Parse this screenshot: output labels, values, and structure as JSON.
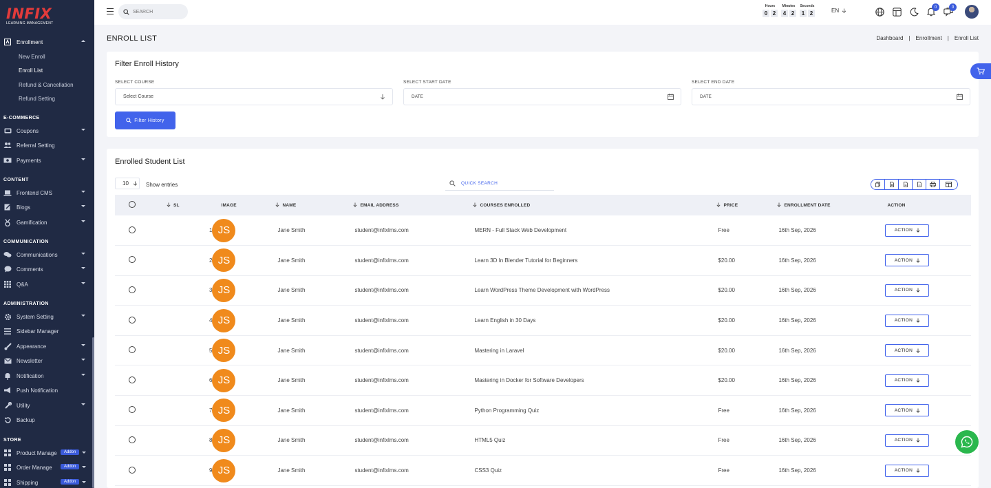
{
  "brand": {
    "logo_text": "INFIX",
    "logo_sub": "LEARNING MANAGEMENT"
  },
  "sidebar": {
    "enrollment": {
      "label": "Enrollment",
      "icon": "enrollment-icon",
      "sub": [
        "New Enroll",
        "Enroll List",
        "Refund & Cancellation",
        "Refund Setting"
      ],
      "active_sub": "Enroll List"
    },
    "sections": {
      "ecommerce": "E-COMMERCE",
      "content": "CONTENT",
      "communication": "COMMUNICATION",
      "administration": "ADMINISTRATION",
      "store": "STORE"
    },
    "ecommerce_items": [
      "Coupons",
      "Referral Setting",
      "Payments"
    ],
    "content_items": [
      "Frontend CMS",
      "Blogs",
      "Gamification"
    ],
    "communication_items": [
      "Communications",
      "Comments",
      "Q&A"
    ],
    "administration_items": [
      "System Setting",
      "Sidebar Manager",
      "Appearance",
      "Newsletter",
      "Notification",
      "Push Notification",
      "Utility",
      "Backup"
    ],
    "store_items": [
      "Product Manage",
      "Order Manage",
      "Shipping"
    ],
    "addon_label": "Addon"
  },
  "topbar": {
    "search_placeholder": "SEARCH",
    "timer": {
      "hours_label": "Hours",
      "minutes_label": "Minutes",
      "seconds_label": "Seconds",
      "hours": [
        "0",
        "2"
      ],
      "minutes": [
        "4",
        "2"
      ],
      "seconds": [
        "1",
        "2"
      ]
    },
    "language": "EN",
    "notification_count": "0",
    "message_count": "0"
  },
  "page": {
    "title": "ENROLL LIST",
    "breadcrumb": [
      "Dashboard",
      "|",
      "Enrollment",
      "|",
      "Enroll List"
    ]
  },
  "filter": {
    "title": "Filter Enroll History",
    "course_label": "SELECT COURSE",
    "course_value": "Select Course",
    "start_label": "SELECT START DATE",
    "start_placeholder": "DATE",
    "end_label": "SELECT END DATE",
    "end_placeholder": "DATE",
    "button": "Filter History"
  },
  "list": {
    "title": "Enrolled Student List",
    "entries": "10",
    "entries_label": "Show entries",
    "quick_search": "QUICK SEARCH",
    "columns": [
      "SL",
      "IMAGE",
      "NAME",
      "EMAIL ADDRESS",
      "COURSES ENROLLED",
      "PRICE",
      "ENROLLMENT DATE",
      "ACTION"
    ],
    "action_label": "ACTION",
    "rows": [
      {
        "sl": "1",
        "initials": "JS",
        "name": "Jane Smith",
        "email": "student@infixlms.com",
        "course": "MERN - Full Stack Web Development",
        "price": "Free",
        "date": "16th Sep, 2026"
      },
      {
        "sl": "2",
        "initials": "JS",
        "name": "Jane Smith",
        "email": "student@infixlms.com",
        "course": "Learn 3D In Blender Tutorial for Beginners",
        "price": "$20.00",
        "date": "16th Sep, 2026"
      },
      {
        "sl": "3",
        "initials": "JS",
        "name": "Jane Smith",
        "email": "student@infixlms.com",
        "course": "Learn WordPress Theme Development with WordPress",
        "price": "$20.00",
        "date": "16th Sep, 2026"
      },
      {
        "sl": "4",
        "initials": "JS",
        "name": "Jane Smith",
        "email": "student@infixlms.com",
        "course": "Learn English in 30 Days",
        "price": "$20.00",
        "date": "16th Sep, 2026"
      },
      {
        "sl": "5",
        "initials": "JS",
        "name": "Jane Smith",
        "email": "student@infixlms.com",
        "course": "Mastering in Laravel",
        "price": "$20.00",
        "date": "16th Sep, 2026"
      },
      {
        "sl": "6",
        "initials": "JS",
        "name": "Jane Smith",
        "email": "student@infixlms.com",
        "course": "Mastering in Docker for Software Developers",
        "price": "$20.00",
        "date": "16th Sep, 2026"
      },
      {
        "sl": "7",
        "initials": "JS",
        "name": "Jane Smith",
        "email": "student@infixlms.com",
        "course": "Python Programming Quiz",
        "price": "Free",
        "date": "16th Sep, 2026"
      },
      {
        "sl": "8",
        "initials": "JS",
        "name": "Jane Smith",
        "email": "student@infixlms.com",
        "course": "HTML5 Quiz",
        "price": "Free",
        "date": "16th Sep, 2026"
      },
      {
        "sl": "9",
        "initials": "JS",
        "name": "Jane Smith",
        "email": "student@infixlms.com",
        "course": "CSS3 Quiz",
        "price": "Free",
        "date": "16th Sep, 2026"
      }
    ]
  },
  "colors": {
    "sidebar": "#202a44",
    "accent": "#4263eb",
    "avatar": "#f08a1c",
    "whatsapp": "#2ab74d",
    "logo": "#e23b3b"
  }
}
